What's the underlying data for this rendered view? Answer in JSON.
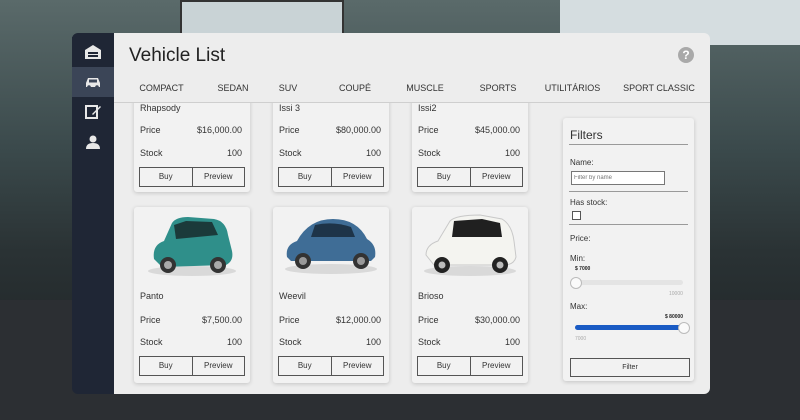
{
  "window": {
    "title": "Vehicle List"
  },
  "sidebar": {
    "items": [
      {
        "icon": "garage-icon"
      },
      {
        "icon": "car-icon"
      },
      {
        "icon": "edit-icon"
      },
      {
        "icon": "user-icon"
      }
    ]
  },
  "tabs": [
    "COMPACT",
    "SEDAN",
    "SUV",
    "COUPÉ",
    "MUSCLE",
    "SPORTS",
    "UTILITÁRIOS",
    "SPORT CLASSIC"
  ],
  "labels": {
    "price": "Price",
    "stock": "Stock",
    "buy": "Buy",
    "preview": "Preview"
  },
  "vehicles": [
    {
      "name": "Rhapsody",
      "price": "$16,000.00",
      "stock": "100"
    },
    {
      "name": "Issi 3",
      "price": "$80,000.00",
      "stock": "100"
    },
    {
      "name": "Issi2",
      "price": "$45,000.00",
      "stock": "100"
    },
    {
      "name": "Panto",
      "price": "$7,500.00",
      "stock": "100",
      "color": "#2f8f8a"
    },
    {
      "name": "Weevil",
      "price": "$12,000.00",
      "stock": "100",
      "color": "#3f6d96"
    },
    {
      "name": "Brioso",
      "price": "$30,000.00",
      "stock": "100",
      "color": "#f4f4f0"
    }
  ],
  "filters": {
    "title": "Filters",
    "name_label": "Name:",
    "name_placeholder": "Filter by name",
    "has_stock_label": "Has stock:",
    "price_label": "Price:",
    "min_label": "Min:",
    "min_value": "$ 7000",
    "min_scale": "10000",
    "min_fraction": 0.0,
    "max_label": "Max:",
    "max_value": "$ 80000",
    "max_scale": "7000",
    "max_fraction": 1.0,
    "button": "Filter"
  },
  "colors": {
    "accent": "#1a5bc4",
    "sidebar": "#1f2635",
    "panel": "#ededed"
  }
}
